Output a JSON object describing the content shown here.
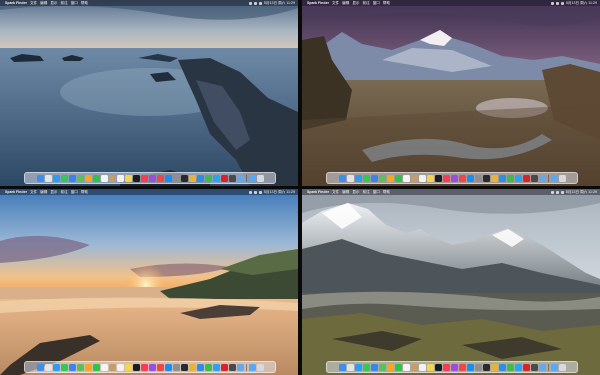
{
  "menubar": {
    "apple": "",
    "app_name": "Spark Finder",
    "menus": [
      "文件",
      "编辑",
      "显示",
      "前往",
      "窗口",
      "帮助"
    ],
    "clock": "5月13日 周六 11:29"
  },
  "dock": {
    "apps": [
      {
        "name": "finder-icon",
        "color": "#3b8ff0"
      },
      {
        "name": "launchpad-icon",
        "color": "#e3e3e8"
      },
      {
        "name": "safari-icon",
        "color": "#2b9df4"
      },
      {
        "name": "messages-icon",
        "color": "#34c759"
      },
      {
        "name": "mail-icon",
        "color": "#3a84f0"
      },
      {
        "name": "maps-icon",
        "color": "#5bbf5b"
      },
      {
        "name": "photos-icon",
        "color": "#f5a623"
      },
      {
        "name": "facetime-icon",
        "color": "#2fc34a"
      },
      {
        "name": "calendar-icon",
        "color": "#f4f4f4"
      },
      {
        "name": "contacts-icon",
        "color": "#c69c6d"
      },
      {
        "name": "reminders-icon",
        "color": "#f2f2f2"
      },
      {
        "name": "notes-icon",
        "color": "#f7d54a"
      },
      {
        "name": "tv-icon",
        "color": "#1c1c1e"
      },
      {
        "name": "music-icon",
        "color": "#fa3b57"
      },
      {
        "name": "podcasts-icon",
        "color": "#9b4de0"
      },
      {
        "name": "news-icon",
        "color": "#f0454a"
      },
      {
        "name": "appstore-icon",
        "color": "#1b8cf2"
      },
      {
        "name": "settings-icon",
        "color": "#8e8e93"
      },
      {
        "name": "terminal-icon",
        "color": "#2a2a2a"
      },
      {
        "name": "chrome-icon",
        "color": "#e8b33a"
      },
      {
        "name": "vscode-icon",
        "color": "#2d8fe3"
      },
      {
        "name": "wechat-icon",
        "color": "#3dbb4d"
      },
      {
        "name": "qq-icon",
        "color": "#2aa3f0"
      },
      {
        "name": "music163-icon",
        "color": "#d8232a"
      },
      {
        "name": "activity-monitor-icon",
        "color": "#4a4a4a"
      },
      {
        "name": "preview-icon",
        "color": "#6aa7e8"
      }
    ],
    "extras": [
      {
        "name": "downloads-folder-icon",
        "color": "#58a8f5"
      },
      {
        "name": "trash-icon",
        "color": "#d7d9de"
      }
    ]
  }
}
